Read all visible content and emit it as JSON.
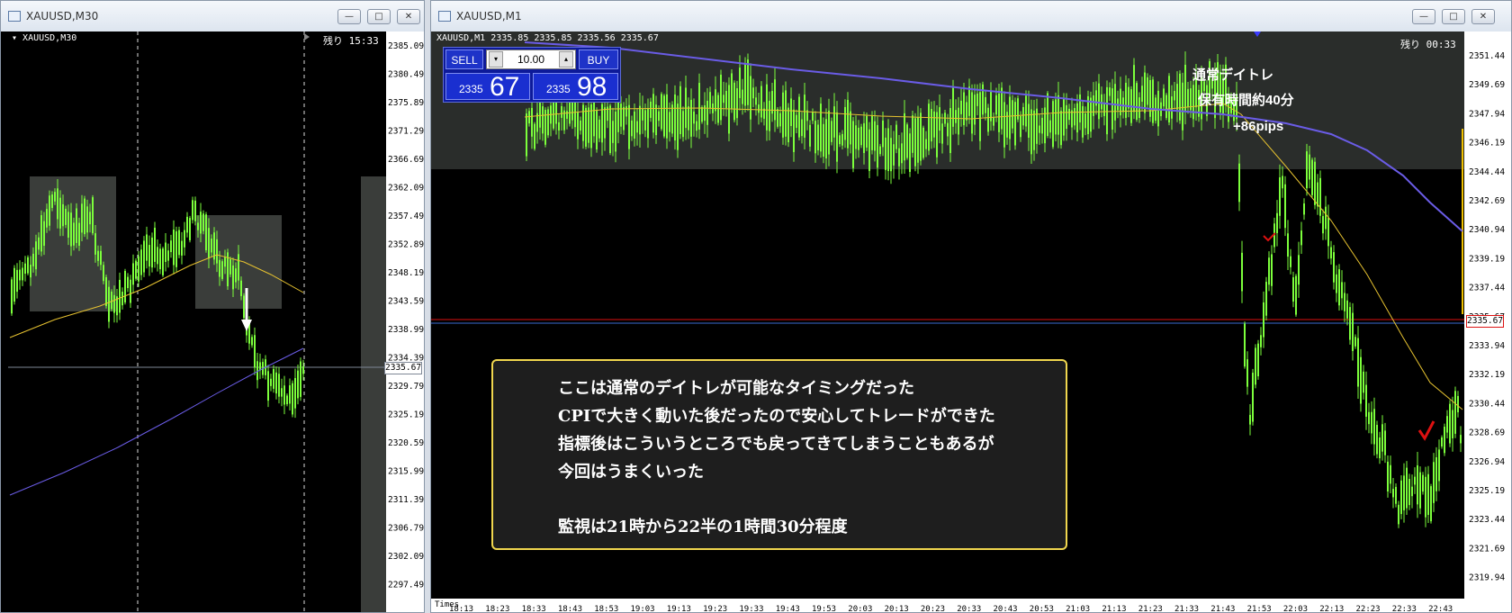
{
  "left_window": {
    "title": "XAUUSD,M30",
    "symbol_label": "XAUUSD,M30",
    "remaining": "残り 15:33",
    "price_labels": [
      "2385.09",
      "2380.49",
      "2375.89",
      "2371.29",
      "2366.69",
      "2362.09",
      "2357.49",
      "2352.89",
      "2348.19",
      "2343.59",
      "2338.99",
      "2334.39",
      "2329.79",
      "2325.19",
      "2320.59",
      "2315.99",
      "2311.39",
      "2306.79",
      "2302.09",
      "2297.49"
    ],
    "current_price": "2335.67"
  },
  "right_window": {
    "title": "XAUUSD,M1",
    "header": "XAUUSD,M1  2335.85 2335.85 2335.56 2335.67",
    "remaining": "残り 00:33",
    "price_labels": [
      "2351.44",
      "2349.69",
      "2347.94",
      "2346.19",
      "2344.44",
      "2342.69",
      "2340.94",
      "2339.19",
      "2337.44",
      "2335.67",
      "2333.94",
      "2332.19",
      "2330.44",
      "2328.69",
      "2326.94",
      "2325.19",
      "2323.44",
      "2321.69",
      "2319.94"
    ],
    "current_price": "2335.67",
    "time_labels": [
      "18:13",
      "18:23",
      "18:33",
      "18:43",
      "18:53",
      "19:03",
      "19:13",
      "19:23",
      "19:33",
      "19:43",
      "19:53",
      "20:03",
      "20:13",
      "20:23",
      "20:33",
      "20:43",
      "20:53",
      "21:03",
      "21:13",
      "21:23",
      "21:33",
      "21:43",
      "21:53",
      "22:03",
      "22:13",
      "22:23",
      "22:33",
      "22:43"
    ],
    "time_axis_label": "Times"
  },
  "trade_panel": {
    "sell_label": "SELL",
    "buy_label": "BUY",
    "lot": "10.00",
    "sell_small": "2335",
    "sell_big": "67",
    "buy_small": "2335",
    "buy_big": "98"
  },
  "annotations": {
    "title": "通常デイトレ",
    "holding": "保有時間約40分",
    "pips": "+86pips"
  },
  "note": {
    "lines": [
      "ここは通常のデイトレが可能なタイミングだった",
      "CPIで大きく動いた後だったので安心してトレードができた",
      "指標後はこういうところでも戻ってきてしまうこともあるが",
      "今回はうまくいった",
      "監視は21時から22半の1時間30分程度"
    ]
  },
  "colors": {
    "candle": "#7cff3c",
    "ma_fast": "#e6c230",
    "ma_slow": "#6a5ce6",
    "price_line": "#d11",
    "note_border": "#f0d64e"
  },
  "window_buttons": {
    "minimize": "—",
    "maximize": "□",
    "close": "✕"
  }
}
